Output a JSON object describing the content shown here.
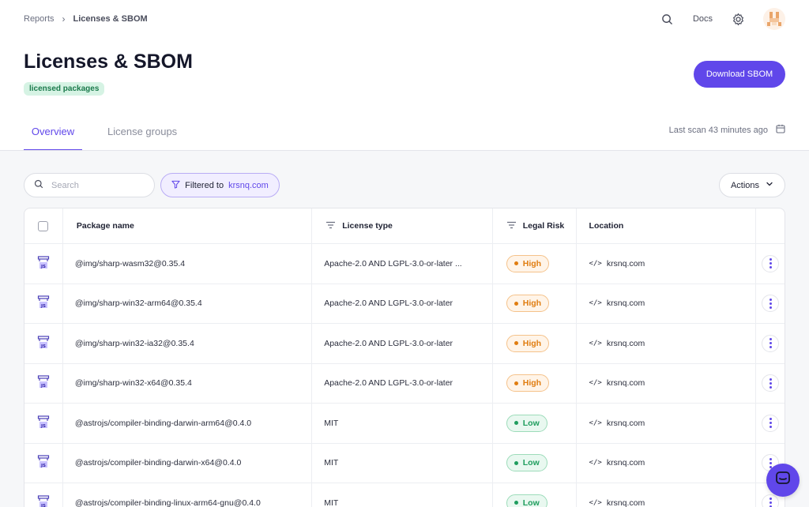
{
  "breadcrumb": {
    "parent": "Reports",
    "separator": "›",
    "current": "Licenses & SBOM"
  },
  "header": {
    "docs_label": "Docs"
  },
  "page": {
    "title": "Licenses & SBOM",
    "badge": "licensed packages",
    "download_button": "Download SBOM"
  },
  "tabs": [
    {
      "label": "Overview",
      "active": true
    },
    {
      "label": "License groups",
      "active": false
    }
  ],
  "last_scan": "Last scan 43 minutes ago",
  "toolbar": {
    "search_placeholder": "Search",
    "filter_prefix": "Filtered to",
    "filter_value": "krsnq.com",
    "actions_label": "Actions"
  },
  "table": {
    "columns": {
      "name": "Package name",
      "license": "License type",
      "risk": "Legal Risk",
      "location": "Location"
    },
    "rows": [
      {
        "name": "@img/sharp-wasm32@0.35.4",
        "license": "Apache-2.0 AND LGPL-3.0-or-later ...",
        "risk": "High",
        "location": "krsnq.com"
      },
      {
        "name": "@img/sharp-win32-arm64@0.35.4",
        "license": "Apache-2.0 AND LGPL-3.0-or-later",
        "risk": "High",
        "location": "krsnq.com"
      },
      {
        "name": "@img/sharp-win32-ia32@0.35.4",
        "license": "Apache-2.0 AND LGPL-3.0-or-later",
        "risk": "High",
        "location": "krsnq.com"
      },
      {
        "name": "@img/sharp-win32-x64@0.35.4",
        "license": "Apache-2.0 AND LGPL-3.0-or-later",
        "risk": "High",
        "location": "krsnq.com"
      },
      {
        "name": "@astrojs/compiler-binding-darwin-arm64@0.4.0",
        "license": "MIT",
        "risk": "Low",
        "location": "krsnq.com"
      },
      {
        "name": "@astrojs/compiler-binding-darwin-x64@0.4.0",
        "license": "MIT",
        "risk": "Low",
        "location": "krsnq.com"
      },
      {
        "name": "@astrojs/compiler-binding-linux-arm64-gnu@0.4.0",
        "license": "MIT",
        "risk": "Low",
        "location": "krsnq.com"
      }
    ]
  },
  "colors": {
    "accent": "#6047ea",
    "high": "#e07d10",
    "low": "#1f9d5e",
    "badge_bg": "#d6f3e4"
  },
  "icons": {
    "package": "js-package-icon",
    "location": "code-icon",
    "menu": "kebab-icon"
  }
}
